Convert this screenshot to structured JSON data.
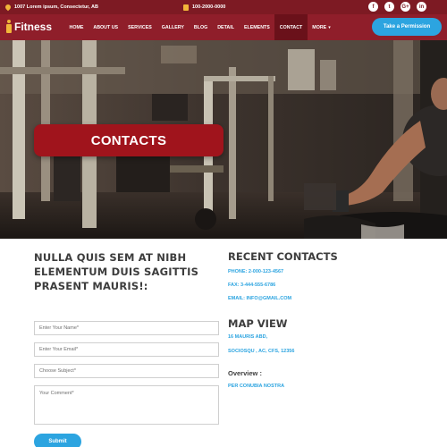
{
  "topbar": {
    "address": "1007 Lorem ipsum, Consectetur, AB",
    "phone": "100-2000-0000",
    "socials": [
      {
        "icon": "facebook-icon",
        "glyph": "f"
      },
      {
        "icon": "twitter-icon",
        "glyph": "t"
      },
      {
        "icon": "google-plus-icon",
        "glyph": "G+"
      },
      {
        "icon": "linkedin-icon",
        "glyph": "in"
      }
    ]
  },
  "brand": {
    "name": "Fitness"
  },
  "nav": {
    "items": [
      {
        "label": "HOME"
      },
      {
        "label": "ABOUT US"
      },
      {
        "label": "SERVICES"
      },
      {
        "label": "GALLERY"
      },
      {
        "label": "BLOG"
      },
      {
        "label": "DETAIL"
      },
      {
        "label": "ELEMENTS"
      },
      {
        "label": "CONTACT",
        "active": true
      },
      {
        "label": "MORE"
      }
    ],
    "cta": "Take a Permission"
  },
  "hero": {
    "title": "CONTACTS"
  },
  "form": {
    "heading": "NULLA QUIS SEM AT NIBH ELEMENTUM DUIS SAGITTIS PRASENT MAURIS!:",
    "name_placeholder": "Enter Your Name*",
    "email_placeholder": "Enter Your Email*",
    "subject_placeholder": "Choose Subject*",
    "comment_placeholder": "Your Comment*",
    "submit": "Submit"
  },
  "contacts": {
    "title": "RECENT CONTACTS",
    "phone": "PHONE: 2-000-123-4567",
    "fax": "FAX: 3-444-555-6786",
    "email": "EMAIL: INFO@GMAIL.COM"
  },
  "map": {
    "title": "MAP VIEW",
    "address_line1": "16 MAURIS ABD,",
    "address_line2": "SOCIOSQU , AC, CFS, 12356",
    "overview_label": "Overview :",
    "overview_text": "PER CONUBIA NOSTRA"
  },
  "colors": {
    "topbar": "#7d1a23",
    "navbar": "#8f1e2a",
    "accent_blue": "#2ca4e0",
    "banner_red": "#a0141c",
    "icon_gold": "#f2b63a"
  }
}
